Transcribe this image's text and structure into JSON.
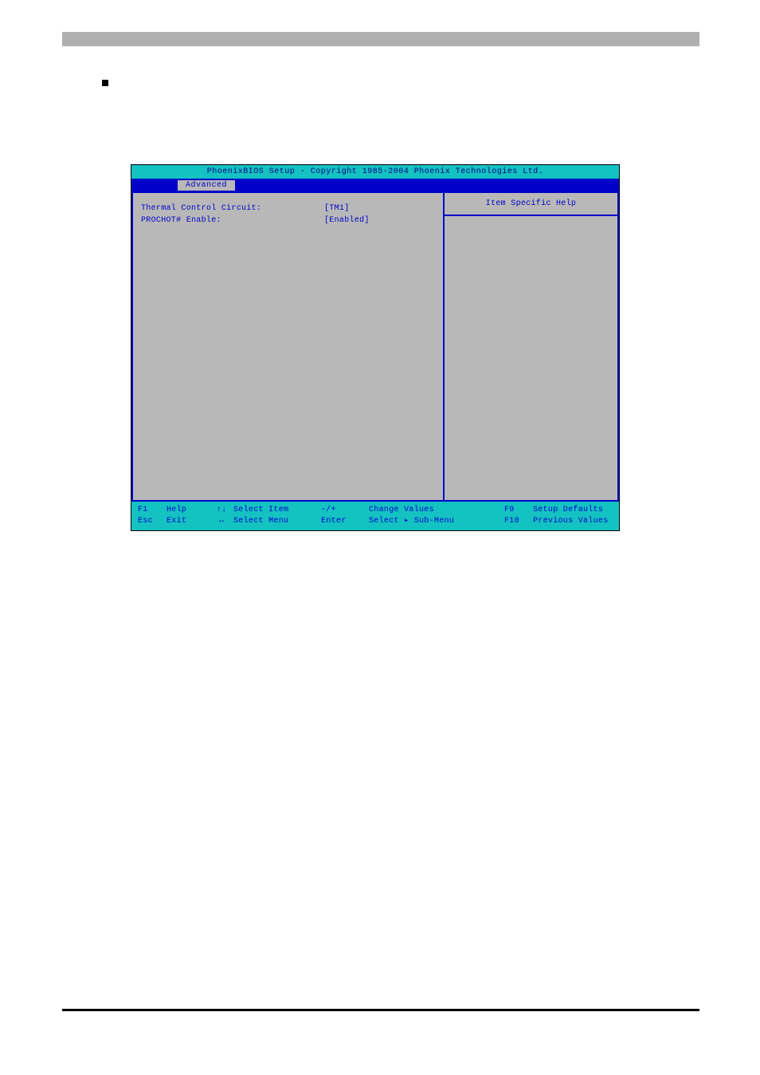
{
  "bios": {
    "title": "PhoenixBIOS Setup - Copyright 1985-2004 Phoenix Technologies Ltd.",
    "menu_tab": "Advanced",
    "settings": [
      {
        "label": "Thermal Control Circuit:",
        "value": "[TM1]"
      },
      {
        "label": "PROCHOT# Enable:",
        "value": "[Enabled]"
      }
    ],
    "help_title": "Item Specific Help",
    "footer": {
      "row1": {
        "f1": "F1",
        "help": "Help",
        "arrow": "↑↓",
        "select_item": "Select Item",
        "change_key": "-/+",
        "change_act": "Change Values",
        "f9": "F9",
        "setup_defaults": "Setup Defaults"
      },
      "row2": {
        "esc": "Esc",
        "exit": "Exit",
        "arrow": "↔",
        "select_menu": "Select Menu",
        "enter": "Enter",
        "submenu": "Select ▸ Sub-Menu",
        "f10": "F10",
        "prev_values": "Previous Values"
      }
    }
  }
}
